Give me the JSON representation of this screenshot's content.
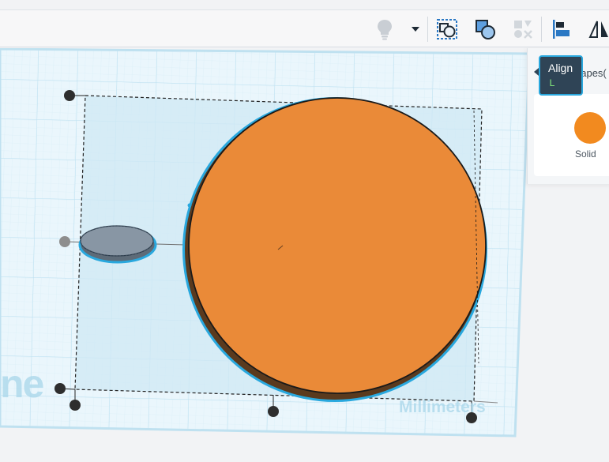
{
  "toolbar": {
    "items": [
      {
        "name": "lightbulb-icon",
        "active": false
      },
      {
        "name": "dropdown-caret-icon",
        "active": true
      },
      {
        "name": "group-icon",
        "active": true
      },
      {
        "name": "ungroup-icon",
        "active": true
      },
      {
        "name": "mirror-disabled-icon",
        "active": false
      },
      {
        "name": "align-icon",
        "active": true
      },
      {
        "name": "flip-icon",
        "active": true
      }
    ]
  },
  "tooltip": {
    "title": "Align",
    "shortcut": "L"
  },
  "shape_panel": {
    "title": "hapes(",
    "solid_label": "Solid",
    "solid_color": "#f28a1f"
  },
  "workplane": {
    "watermark_left": "ne",
    "watermark_units": "Millimeters",
    "grid_color": "#cfe8f3",
    "plane_color": "#e9f5fb"
  },
  "shapes": [
    {
      "name": "orange-cylinder",
      "color": "#e8883a",
      "outline": "#1a1a1a",
      "selected": true
    },
    {
      "name": "hole-cylinder",
      "color": "#7d8b9a",
      "outline": "#2a3a4a",
      "selected": true
    }
  ],
  "colors": {
    "accent": "#29a8de",
    "selection_box": "#2a2a2a",
    "handle": "#2e2e2e"
  }
}
